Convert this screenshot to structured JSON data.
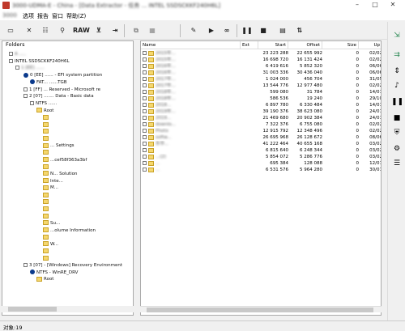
{
  "window": {
    "title": "3000-UDMA-E - China - [Data Extractor - 任务 ... INTEL SSDSCKKF240H6L]",
    "controls": [
      "–",
      "□",
      "✕"
    ]
  },
  "menu": {
    "items": [
      "3000",
      "选项",
      "报告",
      "窗口",
      "帮助(Z)"
    ]
  },
  "toolbar": {
    "raw_label": "RAW"
  },
  "left_pane": {
    "header": "Folders",
    "tree": [
      {
        "indent": 8,
        "icon": "box",
        "text": "A .....",
        "blur": true
      },
      {
        "indent": 8,
        "icon": "box",
        "text": "INTEL SSDSCKKF240H6L",
        "blur": false
      },
      {
        "indent": 16,
        "icon": "box",
        "text": "1 [EE] ......",
        "blur": true
      },
      {
        "indent": 26,
        "icon": "blue",
        "text": "0 [EE] ...... - EFI system partition",
        "blur": false
      },
      {
        "indent": 34,
        "icon": "blue",
        "text": "FAT... ......TGB",
        "blur": false
      },
      {
        "indent": 26,
        "icon": "box",
        "text": "1 [FF] ... Reserved - Microsoft re",
        "blur": false
      },
      {
        "indent": 26,
        "icon": "box",
        "text": "2 [07] ....... Data - Basic data",
        "blur": false
      },
      {
        "indent": 34,
        "icon": "box",
        "text": "NTFS ......",
        "blur": false
      },
      {
        "indent": 42,
        "icon": "fold",
        "text": "Root",
        "blur": false
      },
      {
        "indent": 50,
        "icon": "fold",
        "text": "",
        "blur": true
      },
      {
        "indent": 50,
        "icon": "fold",
        "text": "",
        "blur": true
      },
      {
        "indent": 50,
        "icon": "fold",
        "text": "",
        "blur": true
      },
      {
        "indent": 50,
        "icon": "fold",
        "text": "",
        "blur": true
      },
      {
        "indent": 50,
        "icon": "fold",
        "text": "... Settings",
        "blur": false
      },
      {
        "indent": 50,
        "icon": "fold",
        "text": "",
        "blur": true
      },
      {
        "indent": 50,
        "icon": "fold",
        "text": "...cef58f363a3bf",
        "blur": false
      },
      {
        "indent": 50,
        "icon": "fold",
        "text": "",
        "blur": true
      },
      {
        "indent": 50,
        "icon": "fold",
        "text": "N... Solution",
        "blur": false
      },
      {
        "indent": 50,
        "icon": "fold",
        "text": "Inte...",
        "blur": false
      },
      {
        "indent": 50,
        "icon": "fold",
        "text": "M...",
        "blur": false
      },
      {
        "indent": 50,
        "icon": "fold",
        "text": "",
        "blur": true
      },
      {
        "indent": 50,
        "icon": "fold",
        "text": "",
        "blur": true
      },
      {
        "indent": 50,
        "icon": "fold",
        "text": "",
        "blur": true
      },
      {
        "indent": 50,
        "icon": "fold",
        "text": "",
        "blur": true
      },
      {
        "indent": 50,
        "icon": "fold",
        "text": "Su...",
        "blur": false
      },
      {
        "indent": 50,
        "icon": "fold",
        "text": "...olume Information",
        "blur": false
      },
      {
        "indent": 50,
        "icon": "fold",
        "text": "",
        "blur": true
      },
      {
        "indent": 50,
        "icon": "fold",
        "text": "W...",
        "blur": false
      },
      {
        "indent": 50,
        "icon": "fold",
        "text": "",
        "blur": true
      },
      {
        "indent": 50,
        "icon": "fold",
        "text": "",
        "blur": true
      },
      {
        "indent": 26,
        "icon": "box",
        "text": "3 [07] - [Windows] Recovery Environment",
        "blur": false
      },
      {
        "indent": 34,
        "icon": "blue",
        "text": "NTFS - WinRE_DRV",
        "blur": false
      },
      {
        "indent": 42,
        "icon": "fold",
        "text": "Root",
        "blur": false
      }
    ]
  },
  "right_pane": {
    "columns": [
      "Name",
      "Ext",
      "Start",
      "Offset",
      "Size",
      "Up"
    ],
    "rows": [
      {
        "name": "2015年...",
        "start": "23 223 288",
        "offset": "22 655 992",
        "size": "0",
        "up": "02/02"
      },
      {
        "name": "2015年...",
        "start": "16 698 720",
        "offset": "16 131 424",
        "size": "0",
        "up": "02/02"
      },
      {
        "name": "2016年...",
        "start": "6 419 616",
        "offset": "5 852 320",
        "size": "0",
        "up": "06/06"
      },
      {
        "name": "2016年...",
        "start": "31 003 336",
        "offset": "30 436 040",
        "size": "0",
        "up": "06/06"
      },
      {
        "name": "2017年...",
        "start": "1 024 000",
        "offset": "456 704",
        "size": "0",
        "up": "31/05"
      },
      {
        "name": "2017年...",
        "start": "13 544 776",
        "offset": "12 977 480",
        "size": "0",
        "up": "02/02"
      },
      {
        "name": "2018年...",
        "start": "599 080",
        "offset": "31 784",
        "size": "0",
        "up": "14/01"
      },
      {
        "name": "2018年...",
        "start": "586 536",
        "offset": "19 240",
        "size": "0",
        "up": "29/10"
      },
      {
        "name": "2018...",
        "start": "6 897 780",
        "offset": "6 330 484",
        "size": "0",
        "up": "14/01"
      },
      {
        "name": "2019年...",
        "start": "39 190 376",
        "offset": "38 623 080",
        "size": "0",
        "up": "24/01"
      },
      {
        "name": "2019...",
        "start": "21 469 680",
        "offset": "20 902 384",
        "size": "0",
        "up": "24/01"
      },
      {
        "name": "downlo...",
        "start": "7 322 376",
        "offset": "6 755 080",
        "size": "0",
        "up": "02/02"
      },
      {
        "name": "Photo",
        "start": "12 915 792",
        "offset": "12 348 496",
        "size": "0",
        "up": "02/02"
      },
      {
        "name": "softw...",
        "start": "26 695 968",
        "offset": "26 128 672",
        "size": "0",
        "up": "08/06"
      },
      {
        "name": "东华...",
        "start": "41 222 464",
        "offset": "40 655 168",
        "size": "0",
        "up": "03/02"
      },
      {
        "name": "",
        "start": "6 815 640",
        "offset": "6 248 344",
        "size": "0",
        "up": "03/02"
      },
      {
        "name": "...(2)",
        "start": "5 854 072",
        "offset": "5 286 776",
        "size": "0",
        "up": "03/02"
      },
      {
        "name": "...",
        "start": "695 384",
        "offset": "128 088",
        "size": "0",
        "up": "12/01"
      },
      {
        "name": "...",
        "start": "6 531 576",
        "offset": "5 964 280",
        "size": "0",
        "up": "30/01"
      }
    ]
  },
  "status": {
    "text": "对象:19"
  }
}
